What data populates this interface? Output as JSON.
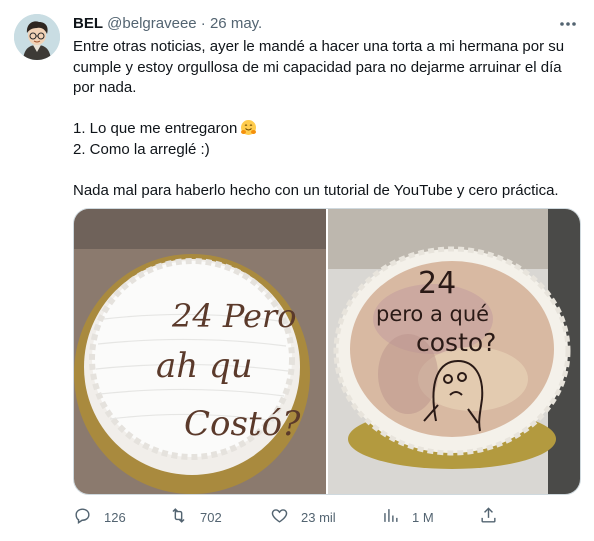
{
  "author": {
    "name": "BEL",
    "handle": "@belgraveee",
    "separator": "·",
    "date": "26 may."
  },
  "tweet": {
    "line1": "Entre otras noticias, ayer le mandé a hacer una torta a mi hermana por su cumple y estoy orgullosa de mi capacidad para no dejarme arruinar el día por nada.",
    "item1": "1. Lo que me entregaron",
    "item1_emoji": "hugging-face-emoji",
    "item2": "2. Como la arreglé :)",
    "line3": "Nada mal para haberlo hecho con un tutorial de YouTube y cero práctica."
  },
  "media": {
    "photo1_text": [
      "24 Pero",
      "ah qu",
      "Costó?"
    ],
    "photo2_text": [
      "24",
      "pero a qué",
      "costo?"
    ]
  },
  "actions": {
    "replies": "126",
    "retweets": "702",
    "likes": "23 mil",
    "views": "1 M"
  },
  "colors": {
    "text": "#0f1419",
    "secondary": "#536471",
    "border": "#cfd9de"
  },
  "icons": [
    "more-icon",
    "reply-icon",
    "retweet-icon",
    "like-icon",
    "views-icon",
    "share-icon"
  ]
}
